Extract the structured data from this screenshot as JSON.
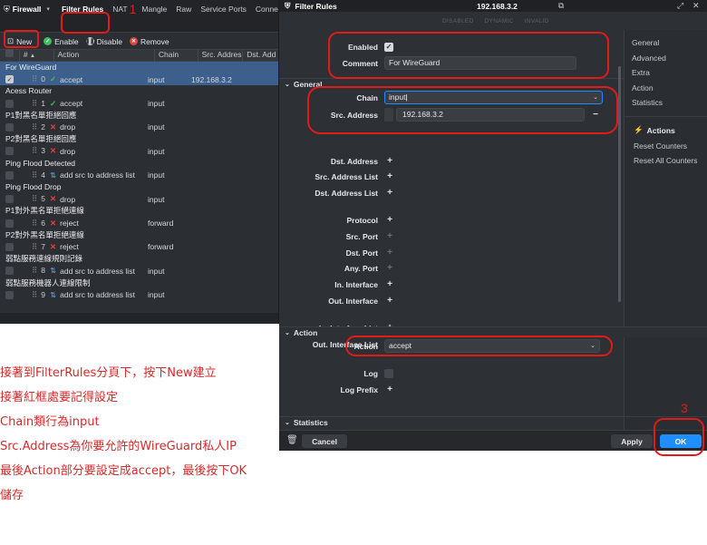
{
  "firewall": {
    "title": "Firewall",
    "tabs": [
      "Filter Rules",
      "NAT",
      "Mangle",
      "Raw",
      "Service Ports",
      "Connec"
    ],
    "toolbar": {
      "new": "New",
      "enable": "Enable",
      "disable": "Disable",
      "remove": "Remove"
    },
    "columns": [
      "#",
      "Action",
      "Chain",
      "Src. Addres",
      "Dst. Add"
    ],
    "groups": [
      {
        "name": "For WireGuard",
        "num": "0",
        "action": "accept",
        "action_type": "accept",
        "chain": "input",
        "src": "192.168.3.2",
        "selected": true
      },
      {
        "name": "Acess Router",
        "num": "1",
        "action": "accept",
        "action_type": "accept",
        "chain": "input",
        "src": "",
        "selected": false
      },
      {
        "name": "P1對黑名單拒絕回應",
        "num": "2",
        "action": "drop",
        "action_type": "drop",
        "chain": "input",
        "src": "",
        "selected": false
      },
      {
        "name": "P2對黑名單拒絕回應",
        "num": "3",
        "action": "drop",
        "action_type": "drop",
        "chain": "input",
        "src": "",
        "selected": false
      },
      {
        "name": "Ping Flood Detected",
        "num": "4",
        "action": "add src to address list",
        "action_type": "add",
        "chain": "input",
        "src": "",
        "selected": false
      },
      {
        "name": "Ping Flood Drop",
        "num": "5",
        "action": "drop",
        "action_type": "drop",
        "chain": "input",
        "src": "",
        "selected": false
      },
      {
        "name": "P1對外黑名單拒絕連線",
        "num": "6",
        "action": "reject",
        "action_type": "drop",
        "chain": "forward",
        "src": "",
        "selected": false
      },
      {
        "name": "P2對外黑名單拒絕連線",
        "num": "7",
        "action": "reject",
        "action_type": "drop",
        "chain": "forward",
        "src": "",
        "selected": false
      },
      {
        "name": "弱點服務連線規則記錄",
        "num": "8",
        "action": "add src to address list",
        "action_type": "add",
        "chain": "input",
        "src": "",
        "selected": false
      },
      {
        "name": "弱點服務機器人連線限制",
        "num": "9",
        "action": "add src to address list",
        "action_type": "add",
        "chain": "input",
        "src": "",
        "selected": false
      }
    ]
  },
  "rule_window": {
    "title": "Filter Rules",
    "address": "192.168.3.2",
    "status_flags": [
      "DISABLED",
      "DYNAMIC",
      "INVALID"
    ],
    "enabled_label": "Enabled",
    "enabled": true,
    "comment_label": "Comment",
    "comment_value": "For WireGuard",
    "general_section": "General",
    "chain_label": "Chain",
    "chain_value": "input",
    "src_address_label": "Src. Address",
    "src_address_value": "192.168.3.2",
    "dst_address_label": "Dst. Address",
    "src_address_list_label": "Src. Address List",
    "dst_address_list_label": "Dst. Address List",
    "protocol_label": "Protocol",
    "src_port_label": "Src. Port",
    "dst_port_label": "Dst. Port",
    "any_port_label": "Any. Port",
    "in_interface_label": "In. Interface",
    "out_interface_label": "Out. Interface",
    "in_interface_list_label": "In. Interface List",
    "out_interface_list_label": "Out. Interface List",
    "action_section": "Action",
    "action_label": "Action",
    "action_value": "accept",
    "log_label": "Log",
    "log_prefix_label": "Log Prefix",
    "statistics_section": "Statistics",
    "cancel": "Cancel",
    "apply": "Apply",
    "ok": "OK",
    "side_nav": [
      "General",
      "Advanced",
      "Extra",
      "Action",
      "Statistics"
    ],
    "actions_title": "Actions",
    "side_actions": [
      "Reset Counters",
      "Reset All Counters"
    ]
  },
  "annotations": {
    "step1": "1",
    "step3": "3",
    "notes": [
      "接著到FilterRules分頁下，按下New建立",
      "接著紅框處要記得設定",
      "Chain類行為input",
      "Src.Address為你要允許的WireGuard私人IP",
      "最後Action部分要設定成accept，最後按下OK",
      "儲存"
    ]
  },
  "colors": {
    "accent_blue": "#1f8fff",
    "annotation_red": "#e31a1a",
    "selected_row": "#3c5f8c"
  }
}
